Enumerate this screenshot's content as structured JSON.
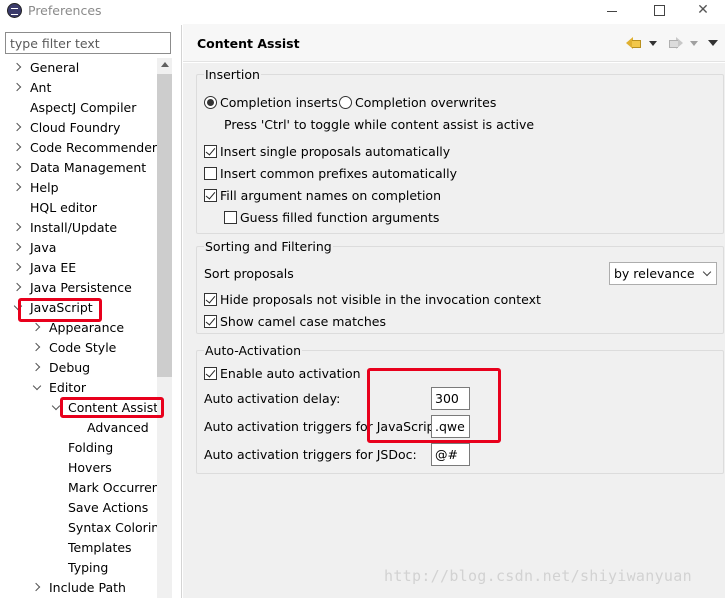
{
  "window": {
    "title": "Preferences",
    "minimize_label": "—",
    "maximize_label": "☐",
    "close_label": "✕"
  },
  "filter": {
    "placeholder": "type filter text"
  },
  "tree": {
    "items": [
      {
        "label": "General"
      },
      {
        "label": "Ant"
      },
      {
        "label": "AspectJ Compiler"
      },
      {
        "label": "Cloud Foundry"
      },
      {
        "label": "Code Recommenders"
      },
      {
        "label": "Data Management"
      },
      {
        "label": "Help"
      },
      {
        "label": "HQL editor"
      },
      {
        "label": "Install/Update"
      },
      {
        "label": "Java"
      },
      {
        "label": "Java EE"
      },
      {
        "label": "Java Persistence"
      },
      {
        "label": "JavaScript"
      },
      {
        "label": "Appearance"
      },
      {
        "label": "Code Style"
      },
      {
        "label": "Debug"
      },
      {
        "label": "Editor"
      },
      {
        "label": "Content Assist"
      },
      {
        "label": "Advanced"
      },
      {
        "label": "Folding"
      },
      {
        "label": "Hovers"
      },
      {
        "label": "Mark Occurren"
      },
      {
        "label": "Save Actions"
      },
      {
        "label": "Syntax Coloring"
      },
      {
        "label": "Templates"
      },
      {
        "label": "Typing"
      },
      {
        "label": "Include Path"
      }
    ]
  },
  "page": {
    "title": "Content Assist"
  },
  "insertion": {
    "title": "Insertion",
    "radio_inserts": "Completion inserts",
    "radio_overwrites": "Completion overwrites",
    "hint": "Press 'Ctrl' to toggle while content assist is active",
    "single_proposals": "Insert single proposals automatically",
    "common_prefixes": "Insert common prefixes automatically",
    "fill_argument_names": "Fill argument names on completion",
    "guess_arguments": "Guess filled function arguments"
  },
  "sorting": {
    "title": "Sorting and Filtering",
    "sort_label": "Sort proposals",
    "sort_value": "by relevance",
    "hide_not_visible": "Hide proposals not visible in the invocation context",
    "camel_case": "Show camel case matches"
  },
  "auto_activation": {
    "title": "Auto-Activation",
    "enable_label": "Enable auto activation",
    "delay_label": "Auto activation delay:",
    "delay_value": "300",
    "triggers_js_label": "Auto activation triggers for JavaScript:",
    "triggers_js_value": ".qwe",
    "triggers_jsdoc_label": "Auto activation triggers for JSDoc:",
    "triggers_jsdoc_value": "@#"
  },
  "watermark": "http://blog.csdn.net/shiyiwanyuan"
}
